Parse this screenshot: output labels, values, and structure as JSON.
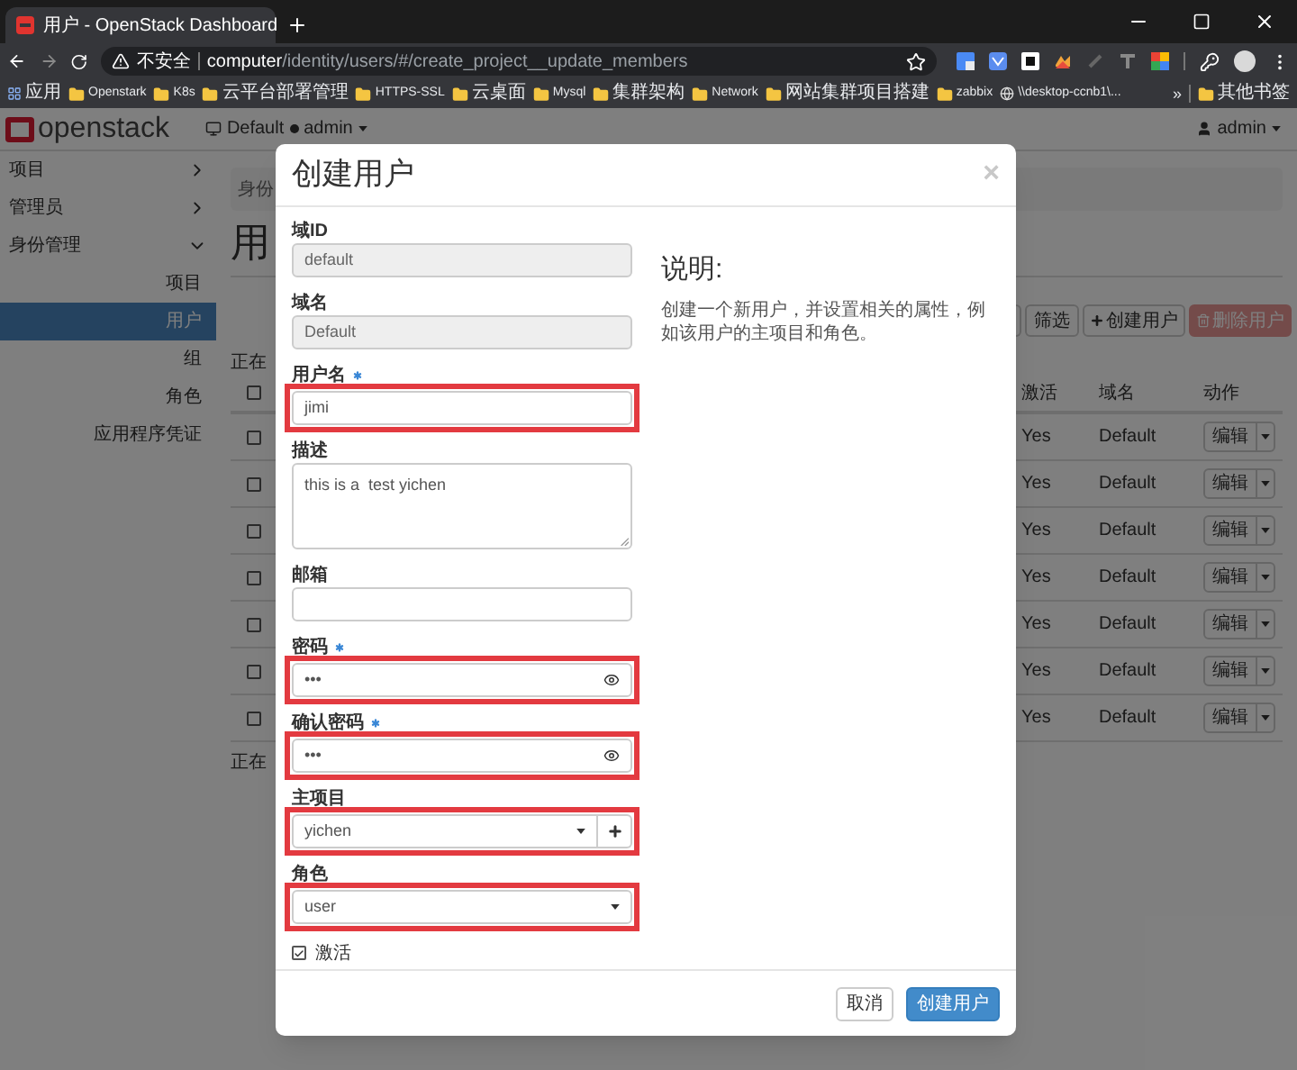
{
  "browser": {
    "tab_title": "用户 - OpenStack Dashboard",
    "security": "不安全",
    "url_host": "computer",
    "url_path": "/identity/users/#/create_project__update_members",
    "bookmarks": [
      {
        "label": "应用",
        "kind": "apps"
      },
      {
        "label": "Openstark",
        "kind": "folder"
      },
      {
        "label": "K8s",
        "kind": "folder"
      },
      {
        "label": "云平台部署管理",
        "kind": "folder"
      },
      {
        "label": "HTTPS-SSL",
        "kind": "folder"
      },
      {
        "label": "云桌面",
        "kind": "folder"
      },
      {
        "label": "Mysql",
        "kind": "folder"
      },
      {
        "label": "集群架构",
        "kind": "folder"
      },
      {
        "label": "Network",
        "kind": "folder"
      },
      {
        "label": "网站集群项目搭建",
        "kind": "folder"
      },
      {
        "label": "zabbix",
        "kind": "folder"
      },
      {
        "label": "\\\\desktop-ccnb1\\...",
        "kind": "link"
      }
    ],
    "more": "»",
    "other_bookmarks": "其他书签"
  },
  "header": {
    "logo": "openstack",
    "project": "Default",
    "project_user": "admin",
    "account": "admin"
  },
  "sidebar": {
    "items": [
      {
        "label": "项目",
        "expanded": false
      },
      {
        "label": "管理员",
        "expanded": false
      },
      {
        "label": "身份管理",
        "expanded": true,
        "children": [
          {
            "label": "项目",
            "selected": false
          },
          {
            "label": "用户",
            "selected": true
          },
          {
            "label": "组",
            "selected": false
          },
          {
            "label": "角色",
            "selected": false
          },
          {
            "label": "应用程序凭证",
            "selected": false
          }
        ]
      }
    ]
  },
  "page": {
    "breadcrumb": "身份",
    "heading": "用",
    "toolbar": {
      "filter": "筛选",
      "create": "创建用户",
      "delete": "删除用户",
      "delete_disabled": true
    },
    "summary_top": "正在",
    "summary_bottom": "正在",
    "table": {
      "header_checked": false,
      "columns": [
        "激活",
        "域名",
        "动作"
      ],
      "rows": [
        {
          "checked": false,
          "active": "Yes",
          "domain": "Default",
          "action": "编辑"
        },
        {
          "checked": false,
          "active": "Yes",
          "domain": "Default",
          "action": "编辑"
        },
        {
          "checked": false,
          "active": "Yes",
          "domain": "Default",
          "action": "编辑"
        },
        {
          "checked": false,
          "active": "Yes",
          "domain": "Default",
          "action": "编辑"
        },
        {
          "checked": false,
          "active": "Yes",
          "domain": "Default",
          "action": "编辑"
        },
        {
          "checked": false,
          "active": "Yes",
          "domain": "Default",
          "action": "编辑"
        },
        {
          "checked": false,
          "active": "Yes",
          "domain": "Default",
          "action": "编辑"
        }
      ]
    }
  },
  "modal": {
    "title": "创建用户",
    "close": "×",
    "fields": [
      {
        "kind": "text",
        "label": "域ID",
        "value": "default",
        "disabled": true,
        "required": false,
        "highlighted": false
      },
      {
        "kind": "text",
        "label": "域名",
        "value": "Default",
        "disabled": true,
        "required": false,
        "highlighted": false
      },
      {
        "kind": "text",
        "label": "用户名",
        "value": "jimi",
        "disabled": false,
        "required": true,
        "highlighted": true
      },
      {
        "kind": "textarea",
        "label": "描述",
        "value": "this is a  test yichen",
        "disabled": false,
        "required": false,
        "highlighted": false
      },
      {
        "kind": "text",
        "label": "邮箱",
        "disabled": false,
        "required": false,
        "highlighted": false
      },
      {
        "kind": "password",
        "label": "密码",
        "value": "•••",
        "disabled": false,
        "required": true,
        "highlighted": true
      },
      {
        "kind": "password",
        "label": "确认密码",
        "value": "•••",
        "disabled": false,
        "required": true,
        "highlighted": true
      },
      {
        "kind": "select",
        "label": "主项目",
        "value": "yichen",
        "addable": true,
        "disabled": false,
        "required": false,
        "highlighted": true
      },
      {
        "kind": "select",
        "label": "角色",
        "value": "user",
        "addable": false,
        "disabled": false,
        "required": false,
        "highlighted": true
      },
      {
        "kind": "checkbox",
        "label": "激活",
        "checked": true
      }
    ],
    "help": {
      "title": "说明:",
      "text": "创建一个新用户，并设置相关的属性，例如该用户的主项目和角色。"
    },
    "buttons": [
      {
        "label": "取消",
        "kind": "default"
      },
      {
        "label": "创建用户",
        "kind": "primary"
      }
    ]
  }
}
